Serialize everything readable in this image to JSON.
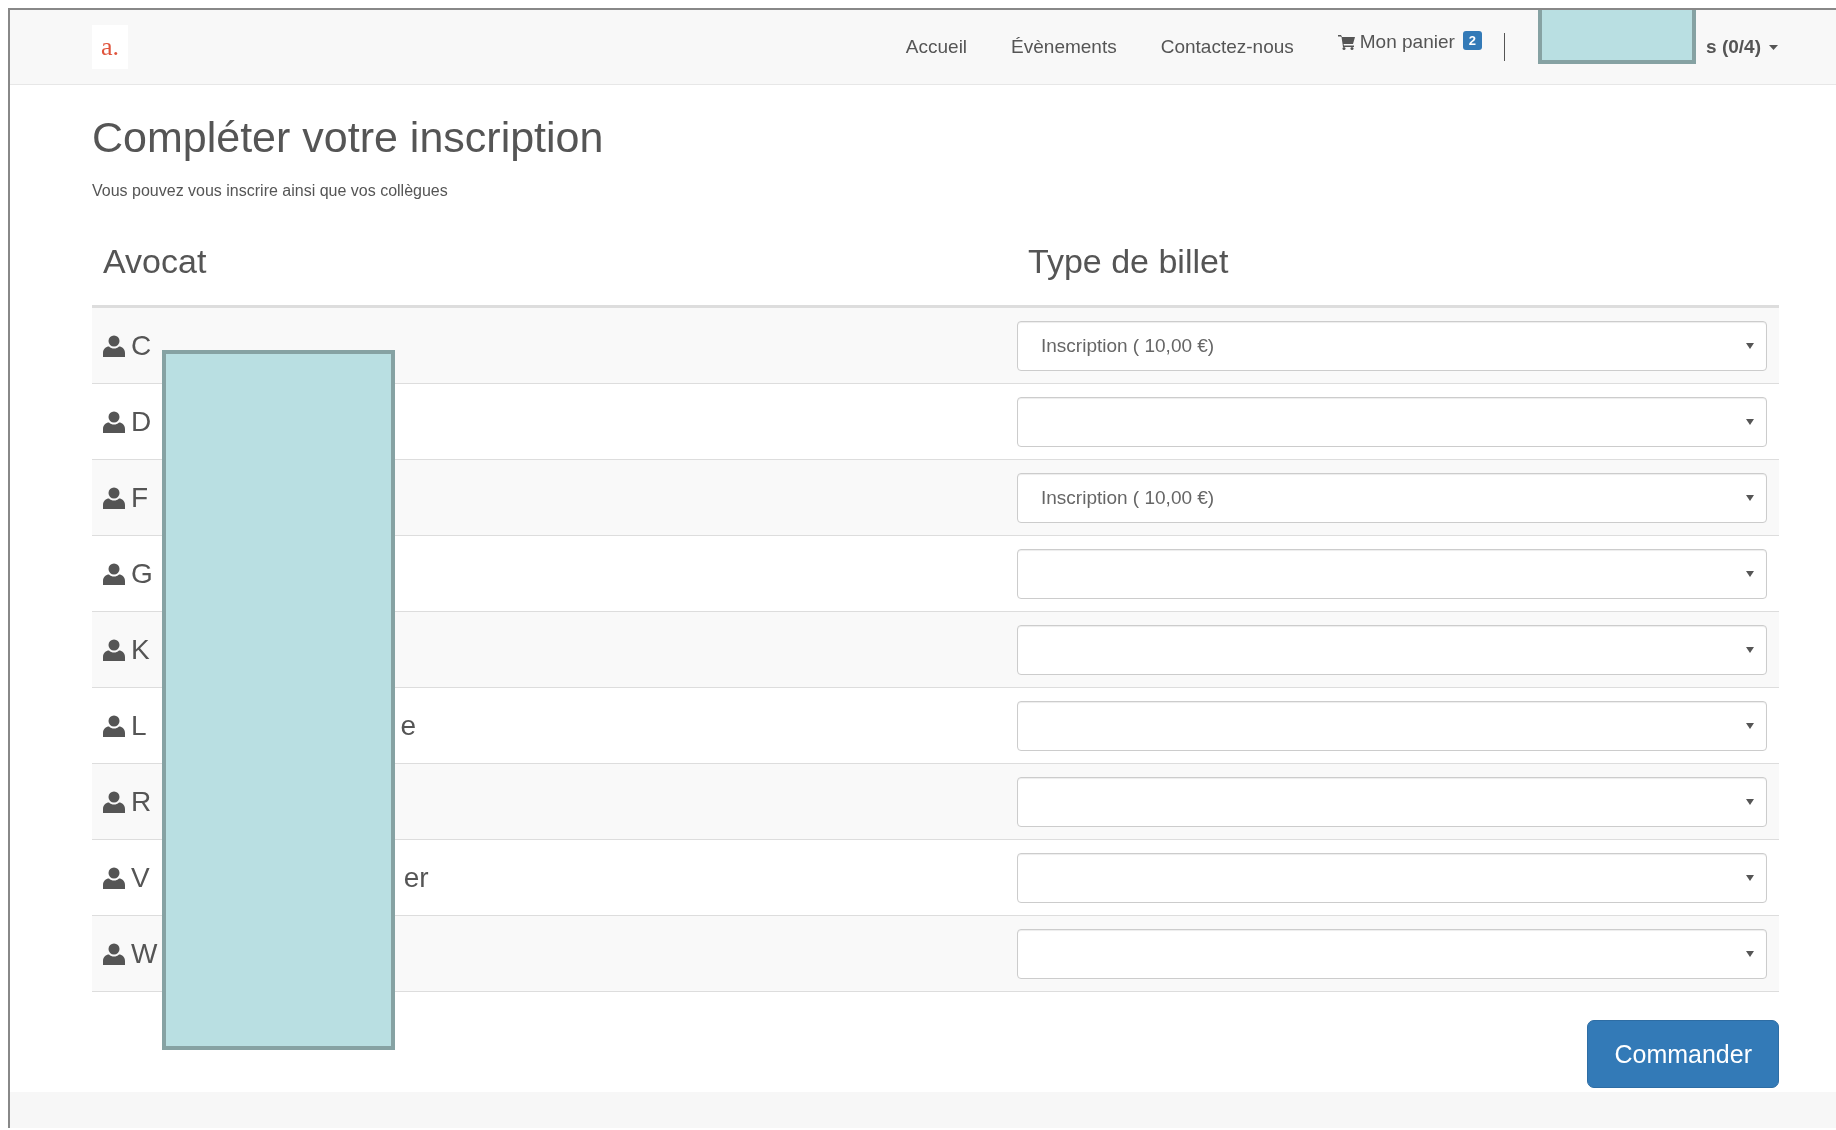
{
  "navbar": {
    "logo": "a.",
    "links": [
      {
        "label": "Accueil",
        "kind": "link"
      },
      {
        "label": "Évènements",
        "kind": "link"
      },
      {
        "label": "Contactez-nous",
        "kind": "link"
      },
      {
        "label": "Mon panier",
        "kind": "cart",
        "badge": "2"
      }
    ],
    "user_menu": "s (0/4)"
  },
  "title": "Compléter votre inscription",
  "subtitle": "Vous pouvez vous inscrire ainsi que vos collègues",
  "table": {
    "columns": [
      "Avocat",
      "Type de billet"
    ],
    "rows": [
      {
        "name_start": "C",
        "ticket": "Inscription ( 10,00 €)"
      },
      {
        "name_start": "D"
      },
      {
        "name_start": "F",
        "ticket": "Inscription ( 10,00 €)"
      },
      {
        "name_start": "G"
      },
      {
        "name_start": "K"
      },
      {
        "name_start": "L",
        "name_end": "e"
      },
      {
        "name_start": "R"
      },
      {
        "name_start": "V",
        "name_end": "er"
      },
      {
        "name_start": "W"
      }
    ]
  },
  "submit": "Commander"
}
